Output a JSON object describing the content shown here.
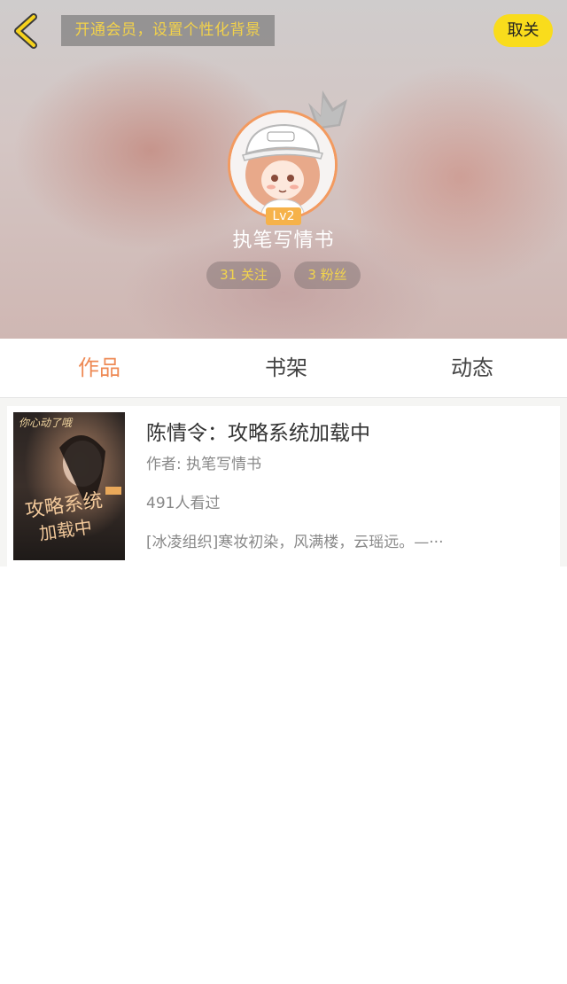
{
  "header": {
    "vip_banner": "开通会员，设置个性化背景",
    "unfollow_label": "取关",
    "level": "Lv2",
    "nickname": "执笔写情书",
    "following": "31 关注",
    "fans": "3 粉丝"
  },
  "tabs": [
    {
      "label": "作品",
      "active": true
    },
    {
      "label": "书架",
      "active": false
    },
    {
      "label": "动态",
      "active": false
    }
  ],
  "books": [
    {
      "title": "陈情令：攻略系统加载中",
      "author": "作者: 执笔写情书",
      "views": "491人看过",
      "description": "[冰凌组织]寒妆初染，风满楼，云瑶远。—···",
      "cover_texts": [
        "你心动了哦",
        "攻略系统",
        "加载中"
      ]
    }
  ],
  "colors": {
    "accent_orange": "#ee8a55",
    "vip_yellow": "#f3d24a",
    "button_yellow": "#f9dc1c",
    "avatar_ring": "#f39a5f"
  },
  "icons": {
    "back": "chevron-left-icon",
    "crown": "crown-icon"
  }
}
